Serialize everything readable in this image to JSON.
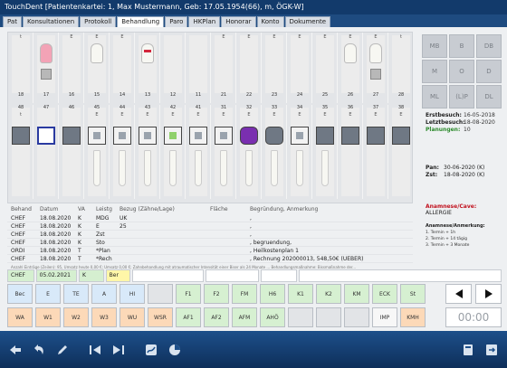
{
  "window": {
    "title": "TouchDent [Patientenkartei: 1,  Max Mustermann, Geb: 17.05.1954(66), m, ÖGK-W]"
  },
  "tabs": [
    "Pat",
    "Konsultationen",
    "Protokoll",
    "Behandlung",
    "Paro",
    "HKPlan",
    "Honorar",
    "Konto",
    "Dokumente"
  ],
  "active_tab": "Behandlung",
  "upper_teeth": [
    {
      "num": "18",
      "mark": "t"
    },
    {
      "num": "17",
      "mark": ""
    },
    {
      "num": "16",
      "mark": "E"
    },
    {
      "num": "15",
      "mark": "E"
    },
    {
      "num": "14",
      "mark": "E"
    },
    {
      "num": "13",
      "mark": ""
    },
    {
      "num": "12",
      "mark": ""
    },
    {
      "num": "11",
      "mark": ""
    },
    {
      "num": "21",
      "mark": "E"
    },
    {
      "num": "22",
      "mark": "E"
    },
    {
      "num": "23",
      "mark": "E"
    },
    {
      "num": "24",
      "mark": "E"
    },
    {
      "num": "25",
      "mark": "E"
    },
    {
      "num": "26",
      "mark": "E"
    },
    {
      "num": "27",
      "mark": "E"
    },
    {
      "num": "28",
      "mark": "t"
    }
  ],
  "lower_teeth": [
    {
      "num": "48",
      "mark": "t"
    },
    {
      "num": "47",
      "mark": ""
    },
    {
      "num": "46",
      "mark": ""
    },
    {
      "num": "45",
      "mark": "E"
    },
    {
      "num": "44",
      "mark": "E"
    },
    {
      "num": "43",
      "mark": "E"
    },
    {
      "num": "42",
      "mark": "E"
    },
    {
      "num": "41",
      "mark": "E"
    },
    {
      "num": "31",
      "mark": "E"
    },
    {
      "num": "32",
      "mark": "E"
    },
    {
      "num": "33",
      "mark": "E"
    },
    {
      "num": "34",
      "mark": "E"
    },
    {
      "num": "35",
      "mark": "E"
    },
    {
      "num": "36",
      "mark": "E"
    },
    {
      "num": "37",
      "mark": "E"
    },
    {
      "num": "38",
      "mark": "E"
    }
  ],
  "surfaces": [
    "MB",
    "B",
    "DB",
    "M",
    "O",
    "D",
    "ML",
    "(L)P",
    "DL"
  ],
  "visit": {
    "erstbesuch_label": "Erstbesuch:",
    "erstbesuch": "16-05-2018",
    "letztbesuch_label": "Letztbesuch:",
    "letztbesuch": "18-08-2020",
    "planungen_label": "Planungen:",
    "planungen": "10",
    "pan_label": "Pan:",
    "pan": "30-06-2020 (K)",
    "zst_label": "Zst:",
    "zst": "18-08-2020 (K)"
  },
  "anamnese": {
    "title": "Anamnese/Cave:",
    "allergie": "ALLERGIE",
    "note_title": "Anamnese/Anmerkung:",
    "lines": [
      "1. Termin + 1h",
      "2. Termin + 14 tägig",
      "3. Termin + 3 Monate"
    ]
  },
  "treatment_list": {
    "headers": [
      "Behand",
      "Datum",
      "VA",
      "Leistg",
      "Bezug (Zähne/Lage)",
      "Fläche",
      "Begründung, Anmerkung"
    ],
    "rows": [
      [
        "CHEF",
        "18.08.2020",
        "K",
        "MDG",
        "UK",
        "",
        ","
      ],
      [
        "CHEF",
        "18.08.2020",
        "K",
        "E",
        "25",
        "",
        ","
      ],
      [
        "CHEF",
        "18.08.2020",
        "K",
        "Zst",
        "",
        "",
        ","
      ],
      [
        "CHEF",
        "18.08.2020",
        "K",
        "Sto",
        "",
        "",
        ", begruendung,"
      ],
      [
        "ORDI",
        "18.08.2020",
        "T",
        "*Plan",
        "",
        "",
        ", Heilkostenplan 1"
      ],
      [
        "CHEF",
        "18.08.2020",
        "T",
        "*Rech",
        "",
        "",
        ", Rechnung 202000013, 548,50€ (UEBER)"
      ]
    ],
    "footnote": "Anzahl Einträge (Zeilen): 95, Umsatz heute 0,00 €; Umsatz 0,00 €; Zahnbehandlung mit atraumatischer Intensität einer Biser als 24 Monate ... Behandlungsmaßnahme: Bissmaßnahme der..."
  },
  "entry": {
    "behand": "CHEF",
    "datum": "05.02.2021",
    "va": "K",
    "leistg": "Ber"
  },
  "quick_row1": [
    {
      "label": "Bec",
      "color": "blue"
    },
    {
      "label": "E",
      "color": "blue"
    },
    {
      "label": "TE",
      "color": "blue"
    },
    {
      "label": "A",
      "color": "blue"
    },
    {
      "label": "HI",
      "color": "blue"
    },
    {
      "label": "",
      "color": "gray"
    },
    {
      "label": "F1",
      "color": "green"
    },
    {
      "label": "F2",
      "color": "green"
    },
    {
      "label": "FM",
      "color": "green"
    },
    {
      "label": "H6",
      "color": "green"
    },
    {
      "label": "K1",
      "color": "green"
    },
    {
      "label": "K2",
      "color": "green"
    },
    {
      "label": "KM",
      "color": "green"
    },
    {
      "label": "ECK",
      "color": "green"
    },
    {
      "label": "St",
      "color": "green"
    }
  ],
  "quick_row2": [
    {
      "label": "WA",
      "color": "orange"
    },
    {
      "label": "W1",
      "color": "orange"
    },
    {
      "label": "W2",
      "color": "orange"
    },
    {
      "label": "W3",
      "color": "orange"
    },
    {
      "label": "WU",
      "color": "orange"
    },
    {
      "label": "WSR",
      "color": "orange"
    },
    {
      "label": "AF1",
      "color": "green"
    },
    {
      "label": "AF2",
      "color": "green"
    },
    {
      "label": "AFM",
      "color": "green"
    },
    {
      "label": "AHÖ",
      "color": "green"
    },
    {
      "label": "",
      "color": "gray"
    },
    {
      "label": "",
      "color": "gray"
    },
    {
      "label": "",
      "color": "gray"
    },
    {
      "label": "IMP",
      "color": "white"
    },
    {
      "label": "KMH",
      "color": "orange"
    }
  ],
  "timer": "00:00",
  "toolbar_icons": [
    "back-icon",
    "undo-icon",
    "edit-icon",
    "first-page-icon",
    "last-page-icon",
    "signature-icon",
    "pie-chart-icon",
    "calculator-icon",
    "exit-icon"
  ]
}
